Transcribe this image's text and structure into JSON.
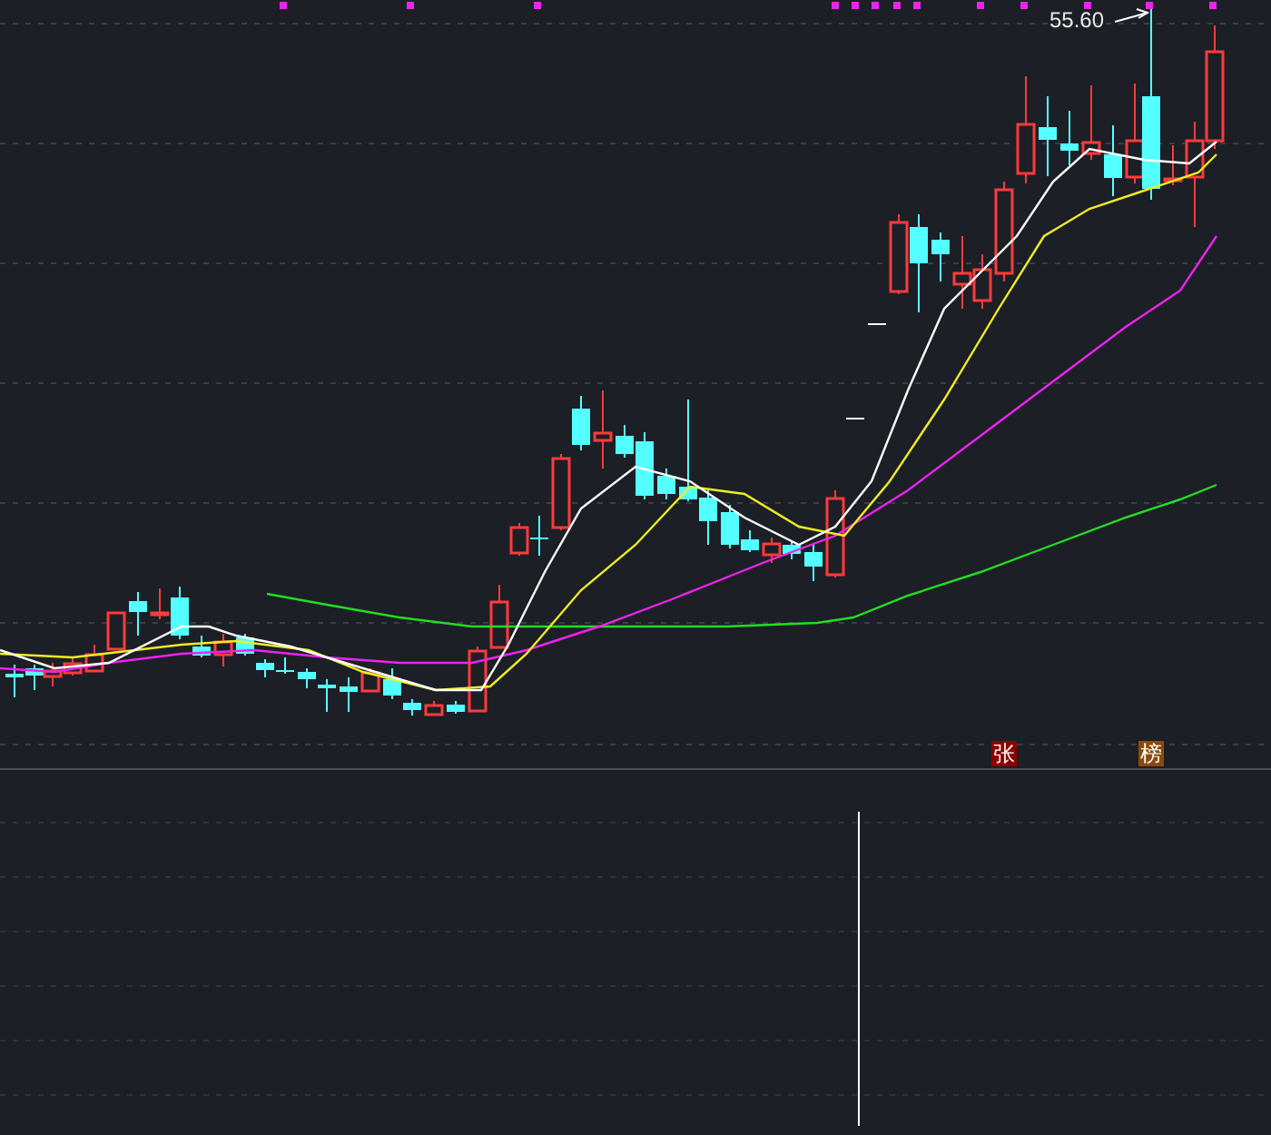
{
  "price_chart": {
    "peak_label": "55.60",
    "markers": [
      {
        "text": "张",
        "color": "#8b0000"
      },
      {
        "text": "榜",
        "color": "#8b4a0a"
      }
    ]
  }
}
